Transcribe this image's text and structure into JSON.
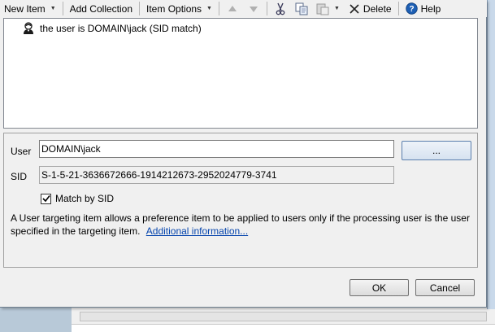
{
  "toolbar": {
    "new_item": "New Item",
    "add_collection": "Add Collection",
    "item_options": "Item Options",
    "delete": "Delete",
    "help": "Help"
  },
  "item_list": {
    "items": [
      {
        "label": "the user is DOMAIN\\jack (SID match)",
        "icon": "user-icon"
      }
    ]
  },
  "properties": {
    "user_label": "User",
    "user_value": "DOMAIN\\jack",
    "browse_label": "...",
    "sid_label": "SID",
    "sid_value": "S-1-5-21-3636672666-1914212673-2952024779-3741",
    "match_by_sid_label": "Match by SID",
    "match_by_sid_checked": true,
    "description": "A User targeting item allows a preference item to be applied to users only if the processing user is the user specified in the targeting item.",
    "additional_info_link": "Additional information..."
  },
  "footer": {
    "ok_label": "OK",
    "cancel_label": "Cancel"
  },
  "colors": {
    "link": "#0645ad",
    "help_icon": "#1d5fb4",
    "dialog_bg": "#f0f0f0"
  }
}
